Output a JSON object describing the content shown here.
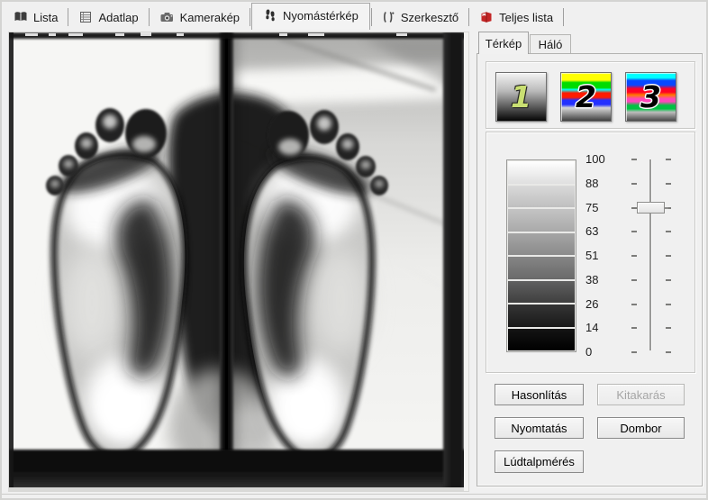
{
  "tabbar": {
    "tabs": [
      {
        "label": "Lista",
        "icon": "book-icon",
        "active": false
      },
      {
        "label": "Adatlap",
        "icon": "datasheet-icon",
        "active": false
      },
      {
        "label": "Kamerakép",
        "icon": "camera-icon",
        "active": false
      },
      {
        "label": "Nyomástérkép",
        "icon": "footprints-icon",
        "active": true
      },
      {
        "label": "Szerkesztő",
        "icon": "editor-icon",
        "active": false
      },
      {
        "label": "Teljes lista",
        "icon": "red-book-icon",
        "active": false
      }
    ]
  },
  "photo": {
    "description": "Grayscale podoscope photograph of two bare foot soles pressed on glass, bright heel and forefoot pads, dark arch shadows, dark vertical frame bar between the feet, dark frame edges, ceiling reflection in upper right"
  },
  "side_panel": {
    "tabs": [
      {
        "label": "Térkép",
        "active": true
      },
      {
        "label": "Háló",
        "active": false
      }
    ],
    "colormap_buttons": [
      {
        "label": "1",
        "palette": "grayscale"
      },
      {
        "label": "2",
        "palette": "rainbow-gray-bands"
      },
      {
        "label": "3",
        "palette": "spectrum-gray-bands"
      }
    ],
    "scale": {
      "labels": [
        "100",
        "88",
        "75",
        "63",
        "51",
        "38",
        "26",
        "14",
        "0"
      ],
      "top_color": "#ffffff",
      "bottom_color": "#000000"
    },
    "slider": {
      "orientation": "vertical",
      "tick_count": 9,
      "handle_tick_index": 2,
      "value_at_handle": "75"
    },
    "buttons": [
      {
        "label": "Hasonlítás",
        "enabled": true
      },
      {
        "label": "Kitakarás",
        "enabled": false
      },
      {
        "label": "Nyomtatás",
        "enabled": true
      },
      {
        "label": "Dombor",
        "enabled": true
      },
      {
        "label": "Lúdtalpmérés",
        "enabled": true
      }
    ]
  },
  "colors": {
    "window_bg": "#f0f0f0",
    "digit1_color": "#c9df72",
    "button_border": "#8a8a8a"
  }
}
